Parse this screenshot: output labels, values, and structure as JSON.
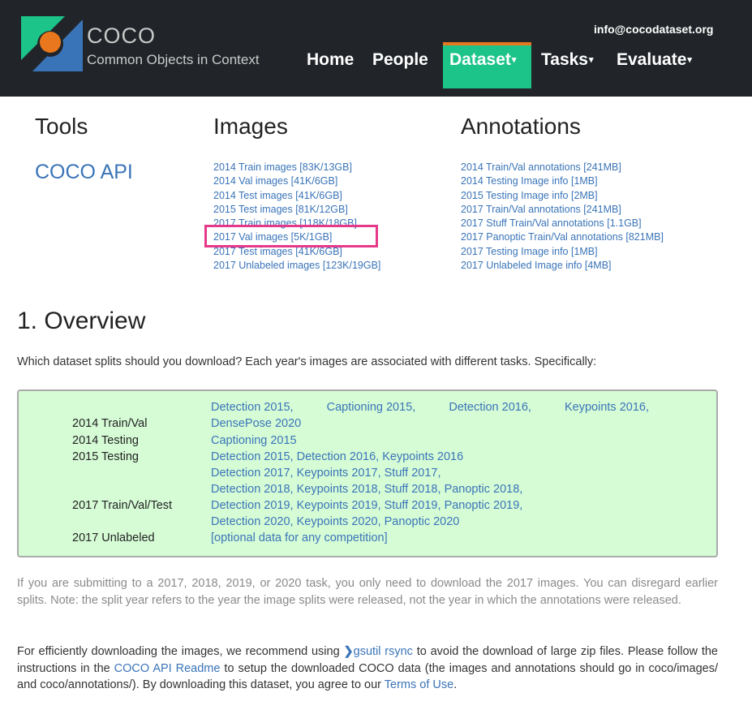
{
  "header": {
    "logo_title": "COCO",
    "logo_subtitle": "Common Objects in Context",
    "email": "info@cocodataset.org",
    "nav": [
      {
        "label": "Home"
      },
      {
        "label": "People"
      },
      {
        "label": "Dataset",
        "active": true
      },
      {
        "label": "Tasks"
      },
      {
        "label": "Evaluate"
      }
    ],
    "caret": "▾",
    "accent_color": "#1cc48a",
    "active_border_color": "#e8771e"
  },
  "downloads": {
    "tools": {
      "heading": "Tools",
      "link": "COCO API"
    },
    "images": {
      "heading": "Images",
      "links": [
        "2014 Train images [83K/13GB]",
        "2014 Val images [41K/6GB]",
        "2014 Test images [41K/6GB]",
        "2015 Test images [81K/12GB]",
        "2017 Train images [118K/18GB]",
        "2017 Val images [5K/1GB]",
        "2017 Test images [41K/6GB]",
        "2017 Unlabeled images [123K/19GB]"
      ],
      "highlighted_index": 5,
      "highlight_color": "#e6398a"
    },
    "annotations": {
      "heading": "Annotations",
      "links": [
        "2014 Train/Val annotations [241MB]",
        "2014 Testing Image info [1MB]",
        "2015 Testing Image info [2MB]",
        "2017 Train/Val annotations [241MB]",
        "2017 Stuff Train/Val annotations [1.1GB]",
        "2017 Panoptic Train/Val annotations [821MB]",
        "2017 Testing Image info [1MB]",
        "2017 Unlabeled Image info [4MB]"
      ]
    }
  },
  "overview": {
    "heading": "1. Overview",
    "intro": "Which dataset splits should you download? Each year's images are associated with different tasks. Specifically:",
    "splits": [
      {
        "label": "2014 Train/Val",
        "tasks": [
          "Detection 2015",
          "Captioning 2015",
          "Detection 2016",
          "Keypoints 2016",
          "DensePose 2020"
        ]
      },
      {
        "label": "2014 Testing",
        "tasks": [
          "Captioning 2015"
        ]
      },
      {
        "label": "2015 Testing",
        "tasks": [
          "Detection 2015",
          "Detection 2016",
          "Keypoints 2016"
        ]
      },
      {
        "label": "2017 Train/Val/Test",
        "tasks": [
          "Detection 2017",
          "Keypoints 2017",
          "Stuff 2017",
          "Detection 2018",
          "Keypoints 2018",
          "Stuff 2018",
          "Panoptic 2018",
          "Detection 2019",
          "Keypoints 2019",
          "Stuff 2019",
          "Panoptic 2019",
          "Detection 2020",
          "Keypoints 2020",
          "Panoptic 2020"
        ]
      },
      {
        "label": "2017 Unlabeled",
        "tasks": [
          "[optional data for any competition]"
        ]
      }
    ],
    "note": "If you are submitting to a 2017, 2018, 2019, or 2020 task, you only need to download the 2017 images. You can disregard earlier splits. Note: the split year refers to the year the image splits were released, not the year in which the annotations were released.",
    "download_para": {
      "text1": "For efficiently downloading the images, we recommend using ",
      "link1": "gsutil rsync",
      "text2": " to avoid the download of large zip files. Please follow the instructions in the ",
      "link2": "COCO API Readme",
      "text3": " to setup the downloaded COCO data (the images and annotations should go in coco/images/ and coco/annotations/). By downloading this dataset, you agree to our ",
      "link3": "Terms of Use",
      "text4": "."
    },
    "box_color": "#d6fcd6"
  }
}
